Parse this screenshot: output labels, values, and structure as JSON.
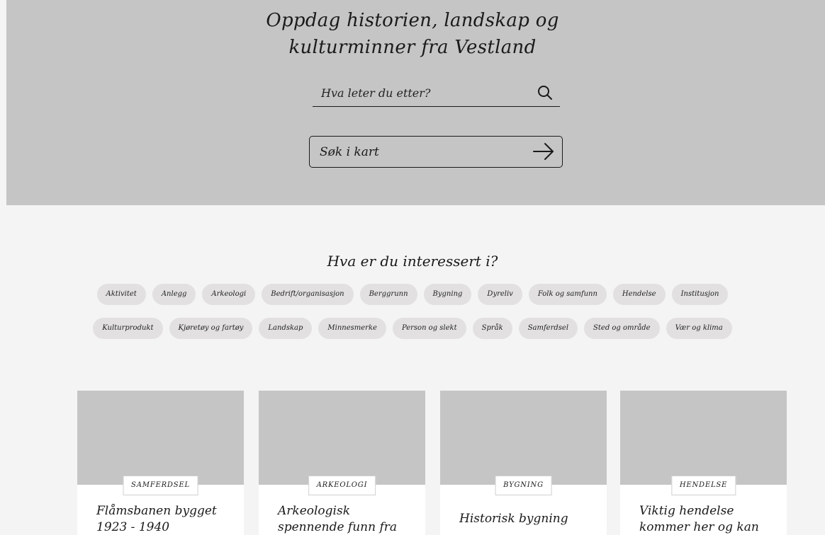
{
  "hero": {
    "title_line1": "Oppdag historien, landskap og",
    "title_line2": "kulturminner fra Vestland",
    "search_placeholder": "Hva leter du etter?",
    "map_button_label": "Søk i kart"
  },
  "interests": {
    "heading": "Hva er du interessert i?",
    "row1": [
      "Aktivitet",
      "Anlegg",
      "Arkeologi",
      "Bedrift/organisasjon",
      "Berggrunn",
      "Bygning",
      "Dyreliv",
      "Folk og samfunn",
      "Hendelse",
      "Institusjon"
    ],
    "row2": [
      "Kulturprodukt",
      "Kjøretøy og fartøy",
      "Landskap",
      "Minnesmerke",
      "Person og slekt",
      "Språk",
      "Samferdsel",
      "Sted og område",
      "Vær og klima"
    ]
  },
  "cards": [
    {
      "category": "SAMFERDSEL",
      "title": "Flåmsbanen bygget 1923 - 1940"
    },
    {
      "category": "ARKEOLOGI",
      "title": "Arkeologisk spennende funn fra vikingtiden"
    },
    {
      "category": "BYGNING",
      "title": "Historisk bygning"
    },
    {
      "category": "HENDELSE",
      "title": "Viktig hendelse kommer her og kan være så lang"
    }
  ]
}
